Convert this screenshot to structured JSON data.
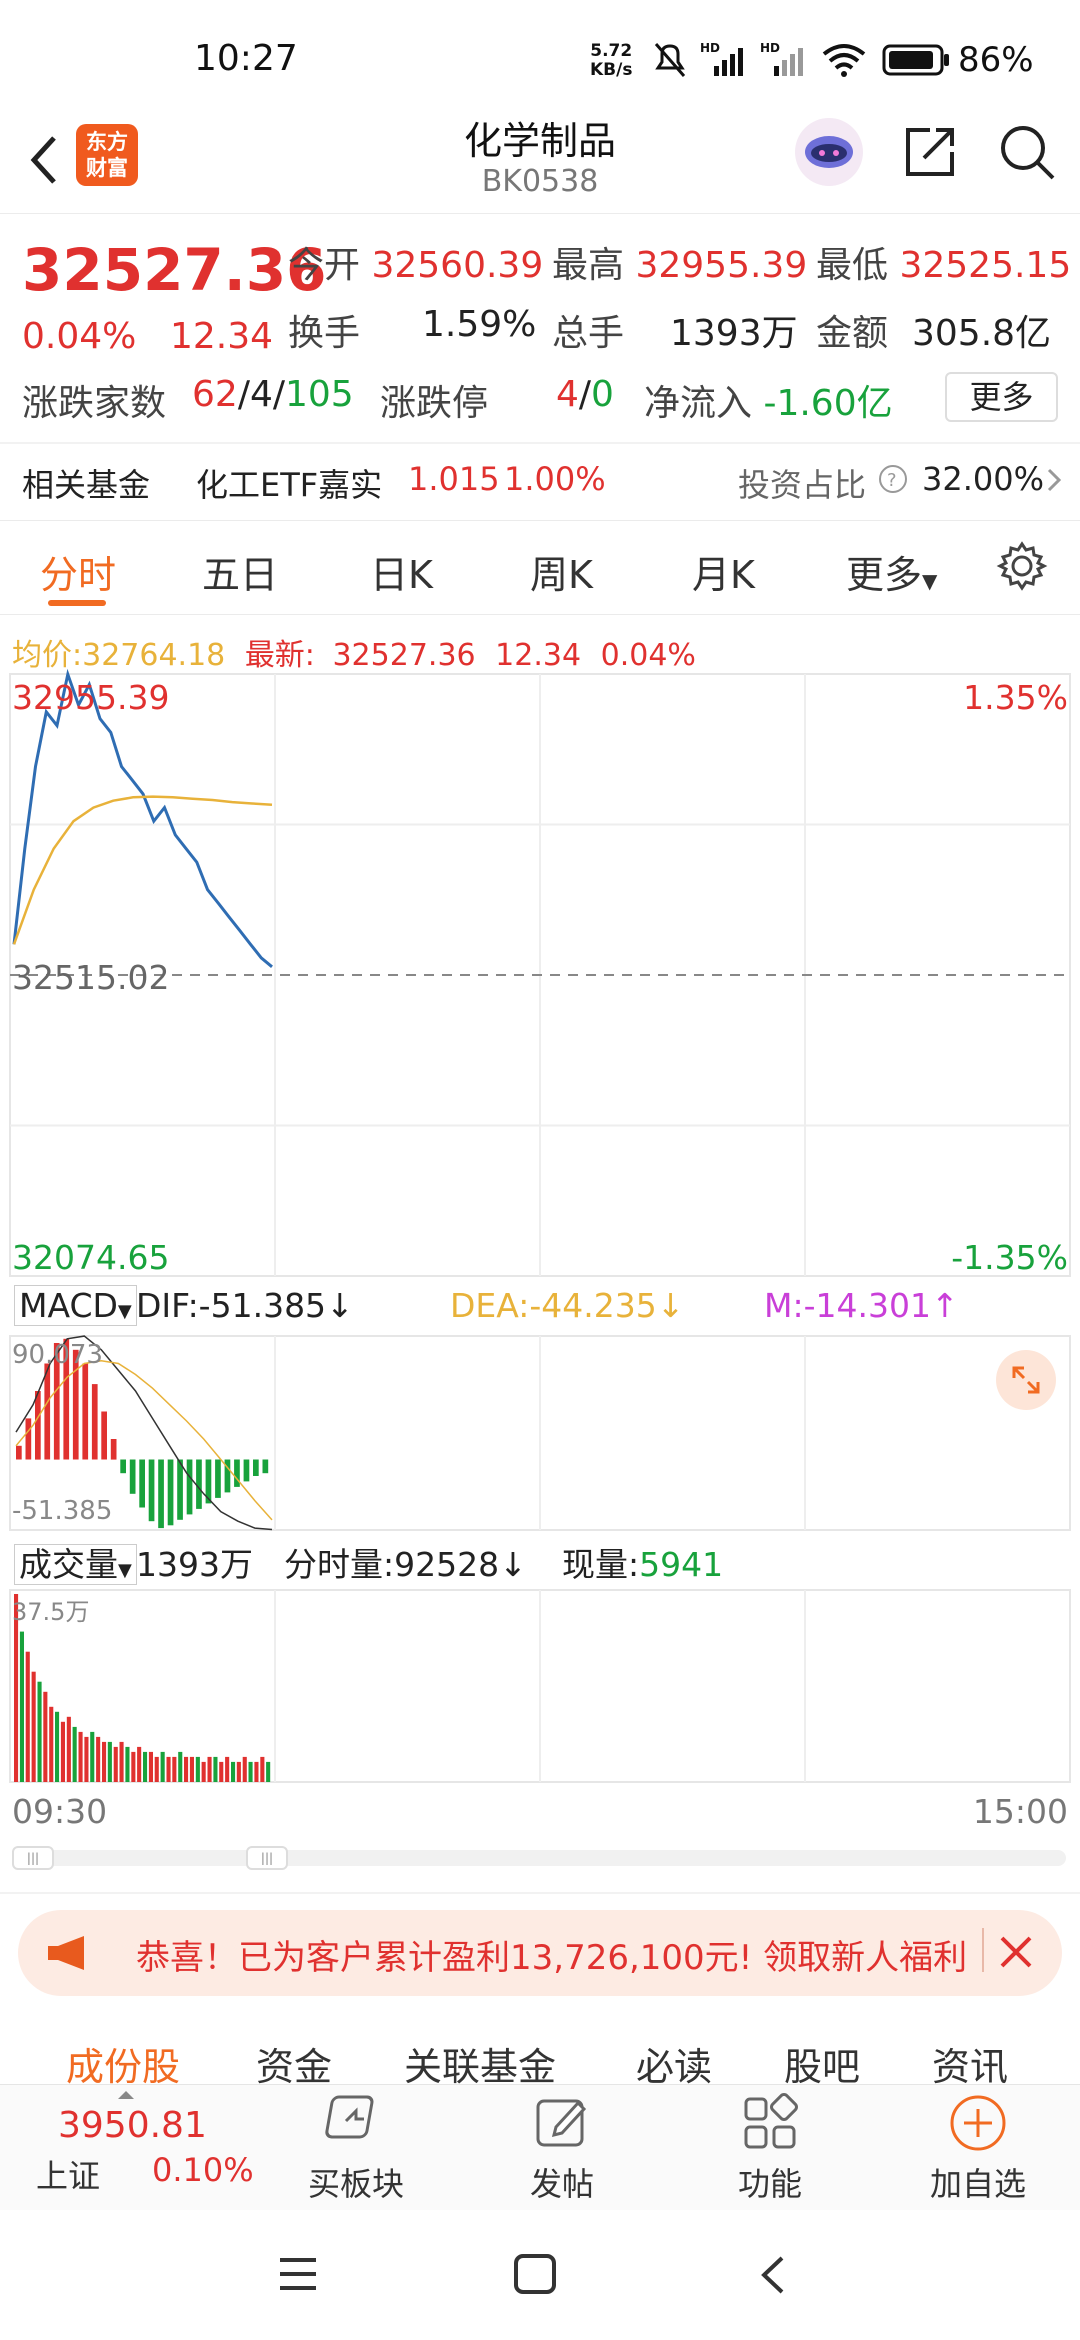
{
  "status_bar": {
    "time": "10:27",
    "net_speed": "5.72",
    "net_unit": "KB/s",
    "battery": "86%"
  },
  "header": {
    "logo_text_1": "东方",
    "logo_text_2": "财富",
    "title": "化学制品",
    "code": "BK0538",
    "icons": [
      "back-icon",
      "robot-avatar-icon",
      "share-icon",
      "search-icon"
    ]
  },
  "quote": {
    "price": "32527.36",
    "change_pct": "0.04%",
    "change_val": "12.34",
    "open_label": "今开",
    "open": "32560.39",
    "high_label": "最高",
    "high": "32955.39",
    "low_label": "最低",
    "low": "32525.15",
    "turnover_label": "换手",
    "turnover": "1.59%",
    "volume_label": "总手",
    "volume": "1393万",
    "amount_label": "金额",
    "amount": "305.8亿",
    "breadth_label": "涨跌家数",
    "breadth_up": "62",
    "breadth_flat": "4",
    "breadth_down": "105",
    "limit_label": "涨跌停",
    "limit_up": "4",
    "limit_down": "0",
    "netflow_label": "净流入",
    "netflow": "-1.60亿",
    "more": "更多"
  },
  "fund": {
    "label": "相关基金",
    "name": "化工ETF嘉实",
    "price": "1.015",
    "change": "1.00%",
    "ratio_label": "投资占比",
    "ratio": "32.00%"
  },
  "tabs": [
    "分时",
    "五日",
    "日K",
    "周K",
    "月K",
    "更多"
  ],
  "chart": {
    "avg_label": "均价:",
    "avg": "32764.18",
    "latest_label": "最新:",
    "latest": "32527.36",
    "latest_chg": "12.34",
    "latest_pct": "0.04%",
    "y_top": "32955.39",
    "y_mid": "32515.02",
    "y_bottom": "32074.65",
    "pct_top": "1.35%",
    "pct_bottom": "-1.35%",
    "macd_label": "MACD",
    "dif": "DIF:-51.385↓",
    "dea": "DEA:-44.235↓",
    "m": "M:-14.301↑",
    "macd_top": "90.073",
    "macd_bottom": "-51.385",
    "vol_label": "成交量",
    "vol_total": "1393万",
    "vol_tick": "分时量:92528↓",
    "vol_now_label": "现量:",
    "vol_now": "5941",
    "vol_max": "37.5万",
    "time_start": "09:30",
    "time_end": "15:00"
  },
  "promo": {
    "text": "恭喜！已为客户累计盈利13,726,100元! 领取新人福利"
  },
  "bottom_tabs": [
    "成份股",
    "资金",
    "关联基金",
    "必读",
    "股吧",
    "资讯"
  ],
  "bottom_bar": {
    "index_value": "3950.81",
    "index_name": "上证",
    "index_pct": "0.10%",
    "buy_label": "买板块",
    "post_label": "发帖",
    "func_label": "功能",
    "add_label": "加自选"
  },
  "colors": {
    "up": "#e0312f",
    "down": "#18a23c",
    "accent": "#f16b22",
    "price_line": "#2f6db3",
    "avg_line": "#e8b23a"
  },
  "chart_data": [
    {
      "type": "line",
      "title": "",
      "ylim": [
        32074.65,
        32955.39
      ],
      "series": [
        {
          "values": [
            32560,
            32700,
            32820,
            32900,
            32880,
            32955,
            32910,
            32940,
            32890,
            32870,
            32820,
            32800,
            32780,
            32740,
            32760,
            32720,
            32700,
            32680,
            32640,
            32620,
            32600,
            32580,
            32560,
            32540,
            32527
          ]
        },
        {
          "values": [
            32560,
            32640,
            32700,
            32740,
            32760,
            32770,
            32775,
            32776,
            32775,
            32773,
            32771,
            32768,
            32766,
            32764
          ]
        }
      ]
    },
    {
      "type": "bar",
      "title": "",
      "ylim": [
        -51.385,
        90.073
      ],
      "values": [
        10,
        30,
        50,
        70,
        85,
        88,
        80,
        70,
        55,
        35,
        15,
        -10,
        -25,
        -35,
        -45,
        -50,
        -48,
        -44,
        -40,
        -36,
        -32,
        -28,
        -24,
        -20,
        -16,
        -12,
        -10
      ]
    },
    {
      "type": "bar",
      "title": "",
      "values": [
        37.5,
        30,
        26,
        22,
        20,
        18,
        15,
        14,
        12,
        13,
        11,
        10,
        9,
        10,
        9,
        8,
        8,
        7,
        8,
        7,
        6,
        7,
        6,
        6,
        5,
        6,
        5,
        5,
        6,
        5,
        5,
        5,
        4,
        5,
        5,
        4,
        5,
        4,
        4,
        5,
        4,
        4,
        5,
        4
      ]
    }
  ]
}
